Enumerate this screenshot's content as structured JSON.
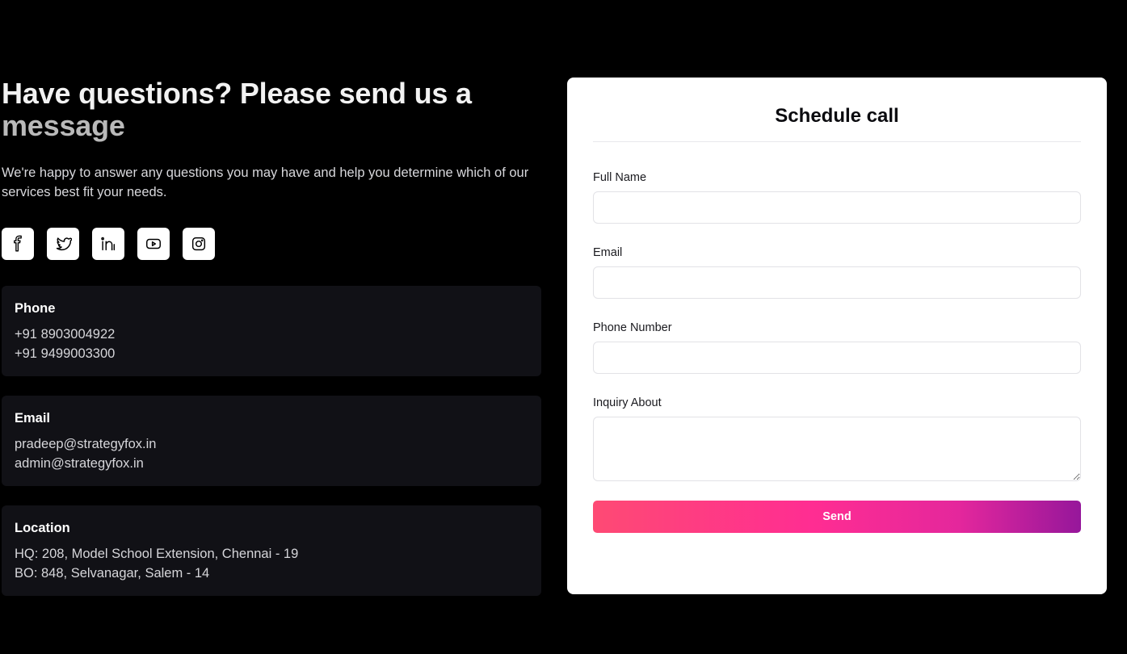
{
  "hero": {
    "headline_main": "Have questions? Please send us a",
    "headline_accent": "message",
    "intro": "We're happy to answer any questions you may have and help you determine which of our services best fit your needs."
  },
  "socials": [
    {
      "icon": "facebook-icon"
    },
    {
      "icon": "twitter-icon"
    },
    {
      "icon": "linkedin-icon"
    },
    {
      "icon": "youtube-icon"
    },
    {
      "icon": "instagram-icon"
    }
  ],
  "contact": {
    "phone": {
      "title": "Phone",
      "lines": [
        "+91 8903004922",
        "+91 9499003300"
      ]
    },
    "email": {
      "title": "Email",
      "lines": [
        "pradeep@strategyfox.in",
        "admin@strategyfox.in"
      ]
    },
    "location": {
      "title": "Location",
      "lines": [
        "HQ: 208, Model School Extension, Chennai - 19",
        "BO: 848, Selvanagar, Salem - 14"
      ]
    }
  },
  "form": {
    "title": "Schedule call",
    "full_name_label": "Full Name",
    "full_name_value": "",
    "email_label": "Email",
    "email_value": "",
    "phone_label": "Phone Number",
    "phone_value": "",
    "inquiry_label": "Inquiry About",
    "inquiry_value": "",
    "send_label": "Send"
  },
  "colors": {
    "background": "#000000",
    "card": "#111116",
    "panel": "#ffffff",
    "send_gradient_start": "#fe4a74",
    "send_gradient_mid": "#ff2d92",
    "send_gradient_end": "#96179b"
  }
}
